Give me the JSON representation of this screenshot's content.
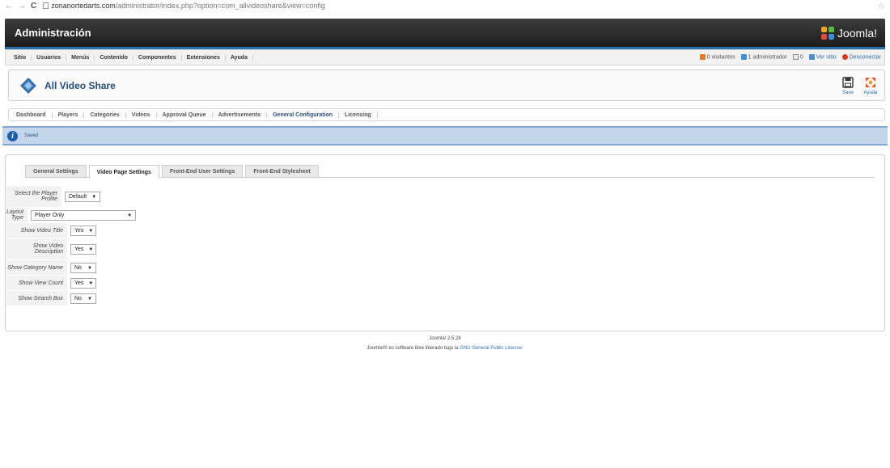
{
  "browser": {
    "back": "←",
    "forward": "→",
    "reload": "C",
    "url_host": "zonanortedarts.com",
    "url_path": "/administrator/index.php?option=com_allvideoshare&view=config",
    "star": "☆"
  },
  "header": {
    "title": "Administración",
    "logo_text": "Joomla!"
  },
  "menubar": {
    "items": [
      "Sitio",
      "Usuarios",
      "Menús",
      "Contenido",
      "Componentes",
      "Extensiones",
      "Ayuda"
    ],
    "visitors": "0 visitantes",
    "admins": "1 administrador",
    "messages": "0",
    "view_site": "Ver sitio",
    "logout": "Desconectar"
  },
  "toolbar": {
    "title": "All Video Share",
    "save_label": "Save",
    "help_label": "Ayuda"
  },
  "submenu": {
    "items": [
      "Dashboard",
      "Players",
      "Categories",
      "Videos",
      "Approval Queue",
      "Advertisements",
      "General Configuration",
      "Licensing"
    ],
    "active_index": 6
  },
  "message": {
    "text": "Saved"
  },
  "tabs": {
    "items": [
      "General Settings",
      "Video Page Settings",
      "Front-End User Settings",
      "Front-End Stylesheet"
    ],
    "active_index": 1
  },
  "form": {
    "player_profile_label": "Select the Player Profile",
    "player_profile_value": "Default",
    "layout_type_label": "Layout Type",
    "layout_type_value": "Player Only",
    "show_video_title_label": "Show Video Title",
    "show_video_title_value": "Yes",
    "show_video_description_label": "Show Video Description",
    "show_video_description_value": "Yes",
    "show_category_name_label": "Show Category Name",
    "show_category_name_value": "No",
    "show_view_count_label": "Show View Count",
    "show_view_count_value": "Yes",
    "show_search_box_label": "Show Search Box",
    "show_search_box_value": "No"
  },
  "footer": {
    "version": "Joomla! 2.5.28",
    "license_prefix": "Joomla!® es software libre liberado bajo la",
    "license_link": "GNU General Public License."
  },
  "colors": {
    "header_bg": "#2a2a2a",
    "accent_blue": "#2b6faa",
    "message_bg": "#c3d6ec"
  }
}
